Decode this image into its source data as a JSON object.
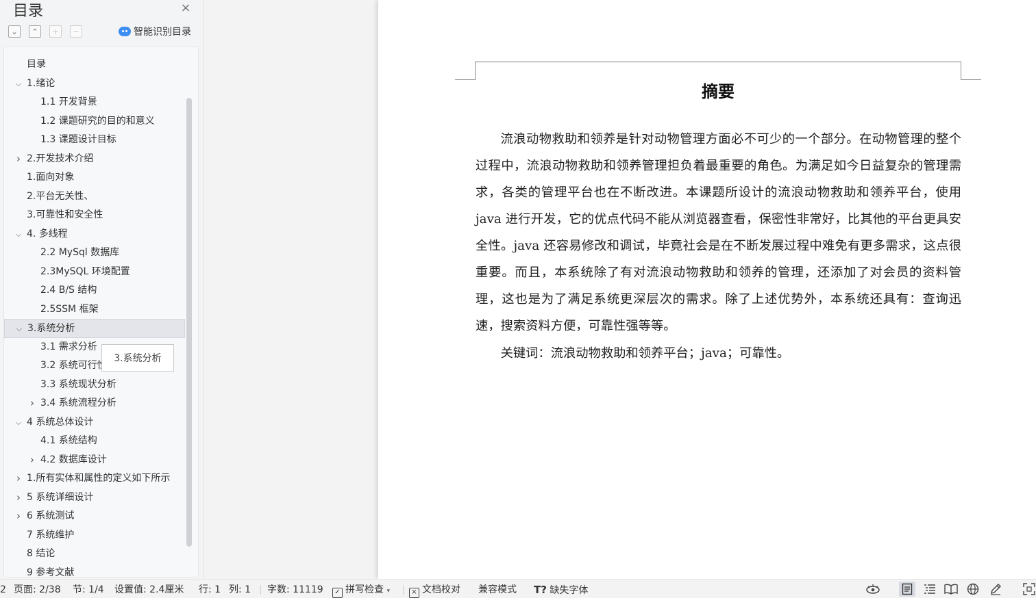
{
  "sidebar": {
    "title": "目录",
    "smart_toc_label": "智能识别目录",
    "tooltip": "3.系统分析",
    "items": [
      {
        "label": "目录",
        "level": 1,
        "arrow": ""
      },
      {
        "label": "1.绪论",
        "level": 1,
        "arrow": "v"
      },
      {
        "label": "1.1 开发背景",
        "level": 2,
        "arrow": ""
      },
      {
        "label": "1.2 课题研究的目的和意义",
        "level": 2,
        "arrow": ""
      },
      {
        "label": "1.3 课题设计目标",
        "level": 2,
        "arrow": ""
      },
      {
        "label": "2.开发技术介绍",
        "level": 1,
        "arrow": ">"
      },
      {
        "label": "1.面向对象",
        "level": 1,
        "arrow": ""
      },
      {
        "label": "2.平台无关性、",
        "level": 1,
        "arrow": ""
      },
      {
        "label": "3.可靠性和安全性",
        "level": 1,
        "arrow": ""
      },
      {
        "label": "4. 多线程",
        "level": 1,
        "arrow": "v"
      },
      {
        "label": "2.2 MySql 数据库",
        "level": 2,
        "arrow": ""
      },
      {
        "label": "2.3MySQL 环境配置",
        "level": 2,
        "arrow": ""
      },
      {
        "label": "2.4 B/S 结构",
        "level": 2,
        "arrow": ""
      },
      {
        "label": "2.5SSM 框架",
        "level": 2,
        "arrow": ""
      },
      {
        "label": "3.系统分析",
        "level": 1,
        "arrow": "v",
        "selected": true
      },
      {
        "label": "3.1 需求分析",
        "level": 2,
        "arrow": ""
      },
      {
        "label": "3.2 系统可行性分析",
        "level": 2,
        "arrow": ""
      },
      {
        "label": "3.3  系统现状分析",
        "level": 2,
        "arrow": ""
      },
      {
        "label": "3.4 系统流程分析",
        "level": 2,
        "arrow": ">"
      },
      {
        "label": "4 系统总体设计",
        "level": 1,
        "arrow": "v"
      },
      {
        "label": "4.1 系统结构",
        "level": 2,
        "arrow": ""
      },
      {
        "label": "4.2 数据库设计",
        "level": 2,
        "arrow": ">"
      },
      {
        "label": "1.所有实体和属性的定义如下所示",
        "level": 1,
        "arrow": ">"
      },
      {
        "label": "5  系统详细设计",
        "level": 1,
        "arrow": ">"
      },
      {
        "label": "6  系统测试",
        "level": 1,
        "arrow": ">"
      },
      {
        "label": "7  系统维护",
        "level": 1,
        "arrow": ""
      },
      {
        "label": "8  结论",
        "level": 1,
        "arrow": ""
      },
      {
        "label": "9  参考文献",
        "level": 1,
        "arrow": ""
      }
    ]
  },
  "document": {
    "title": "摘要",
    "body": "流浪动物救助和领养是针对动物管理方面必不可少的一个部分。在动物管理的整个过程中，流浪动物救助和领养管理担负着最重要的角色。为满足如今日益复杂的管理需求，各类的管理平台也在不断改进。本课题所设计的流浪动物救助和领养平台，使用 java 进行开发，它的优点代码不能从浏览器查看，保密性非常好，比其他的平台更具安全性。java 还容易修改和调试，毕竟社会是在不断发展过程中难免有更多需求，这点很重要。而且，本系统除了有对流浪动物救助和领养的管理，还添加了对会员的资料管理，这也是为了满足系统更深层次的需求。除了上述优势外，本系统还具有：查询迅速，搜索资料方便，可靠性强等等。",
    "keywords": "关键词：流浪动物救助和领养平台；java；可靠性。"
  },
  "statusbar": {
    "edge_text": "2",
    "page": "页面: 2/38",
    "section": "节: 1/4",
    "setting": "设置值: 2.4厘米",
    "line": "行: 1",
    "column": "列: 1",
    "word_count": "字数: 11119",
    "spell_check": "拼写检查",
    "doc_proof": "文档校对",
    "compat_mode": "兼容模式",
    "missing_font": "缺失字体"
  }
}
